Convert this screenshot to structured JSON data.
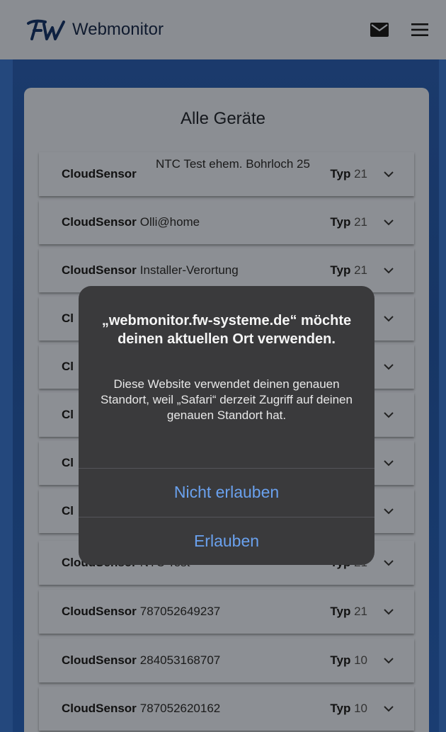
{
  "header": {
    "logo_text": "FW",
    "title": "Webmonitor",
    "mail_icon": "mail-icon",
    "menu_icon": "hamburger-menu-icon"
  },
  "page": {
    "title": "Alle Geräte"
  },
  "devices": [
    {
      "type": "CloudSensor",
      "name": "NTC Test ehem. Bohrloch 25",
      "typ_label": "Typ",
      "typ_value": "21"
    },
    {
      "type": "CloudSensor",
      "name": "Olli@home",
      "typ_label": "Typ",
      "typ_value": "21"
    },
    {
      "type": "CloudSensor",
      "name": "Installer-Verortung",
      "typ_label": "Typ",
      "typ_value": "21"
    },
    {
      "type": "Cl",
      "name": "",
      "typ_label": "",
      "typ_value": ""
    },
    {
      "type": "Cl",
      "name": "",
      "typ_label": "",
      "typ_value": ""
    },
    {
      "type": "Cl",
      "name": "",
      "typ_label": "",
      "typ_value": ""
    },
    {
      "type": "Cl",
      "name": "",
      "typ_label": "",
      "typ_value": ""
    },
    {
      "type": "Cl",
      "name": "",
      "typ_label": "",
      "typ_value": ""
    },
    {
      "type": "CloudSensor",
      "name": "NTC Test",
      "typ_label": "Typ",
      "typ_value": "21"
    },
    {
      "type": "CloudSensor",
      "name": "787052649237",
      "typ_label": "Typ",
      "typ_value": "21"
    },
    {
      "type": "CloudSensor",
      "name": "284053168707",
      "typ_label": "Typ",
      "typ_value": "10"
    },
    {
      "type": "CloudSensor",
      "name": "787052620162",
      "typ_label": "Typ",
      "typ_value": "10"
    }
  ],
  "dialog": {
    "title": "„webmonitor.fw-systeme.de“ möchte deinen aktuellen Ort verwenden.",
    "message": "Diese Website verwendet deinen genauen Standort, weil „Safari“ derzeit Zugriff auf deinen genauen Standort hat.",
    "deny_label": "Nicht erlauben",
    "allow_label": "Erlauben"
  },
  "colors": {
    "header_bg": "#8a8d92",
    "backdrop": "#1b3a6c",
    "dialog_bg": "#3a3a3c",
    "dialog_button": "#6aa1ee"
  }
}
